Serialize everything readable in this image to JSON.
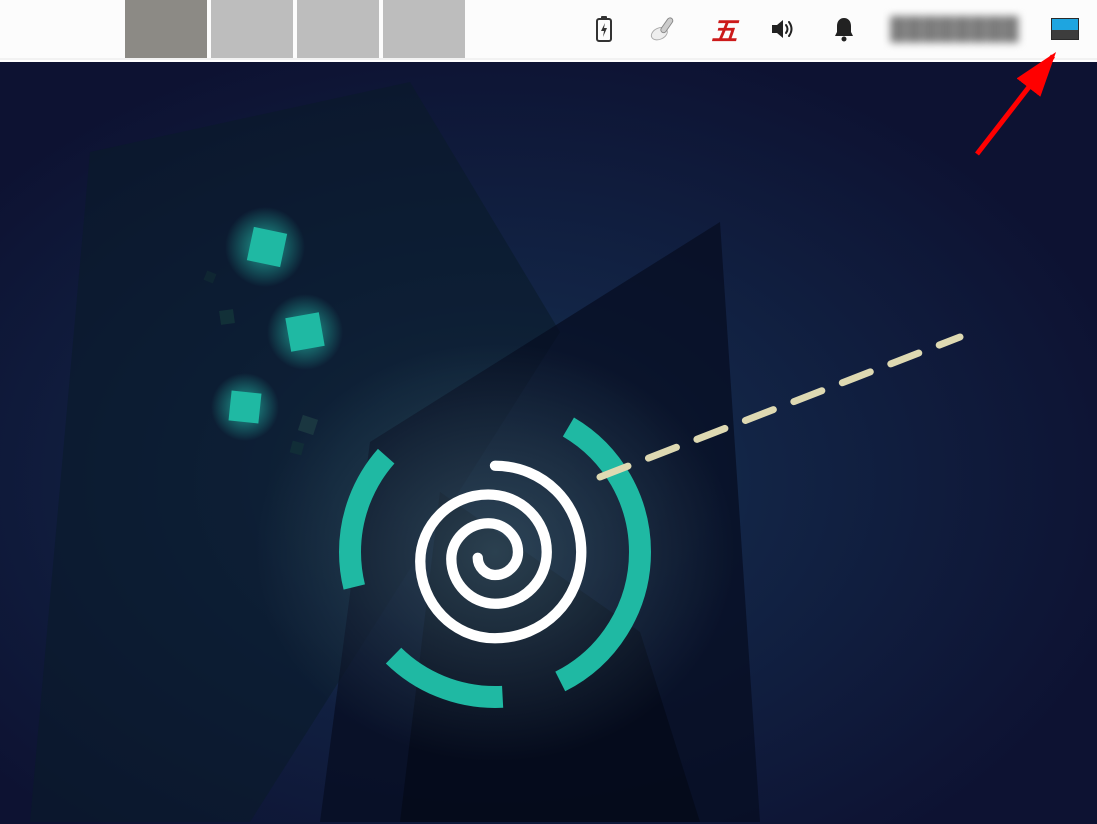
{
  "panel": {
    "workspaces": [
      {
        "active": true
      },
      {
        "active": false
      },
      {
        "active": false
      },
      {
        "active": false
      }
    ],
    "tray": {
      "battery_icon": "battery",
      "input_tool_icon": "tool",
      "ime_label": "五",
      "volume_icon": "volume",
      "notifications_icon": "bell",
      "user_area_text": "████████",
      "show_desktop_icon": "show-desktop"
    }
  },
  "wallpaper": {
    "variant": "debian-swirl-teal",
    "bg_color": "#0d1232",
    "accent_color": "#1fb9a3"
  },
  "annotation": {
    "arrow_color": "#ff0000",
    "target": "show-desktop"
  }
}
